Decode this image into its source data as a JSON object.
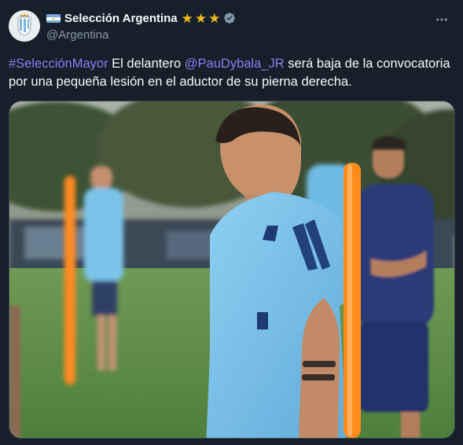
{
  "author": {
    "display_name": "Selección Argentina",
    "handle": "@Argentina",
    "stars": 3,
    "verified": true
  },
  "tweet": {
    "hashtag": "#SelecciónMayor",
    "text_part1": " El delantero ",
    "mention": "@PauDybala_JR",
    "text_part2": " será baja de la convocatoria por una pequeña lesión en el aductor de su pierna derecha."
  },
  "colors": {
    "background": "#15202b",
    "link": "#8c7cf0",
    "star": "#f5b71a",
    "secondary_text": "#8b98a5"
  },
  "icons": {
    "avatar": "afa-crest-icon",
    "flag": "argentina-flag-icon",
    "verified": "verified-badge-icon",
    "more": "more-options-icon"
  }
}
